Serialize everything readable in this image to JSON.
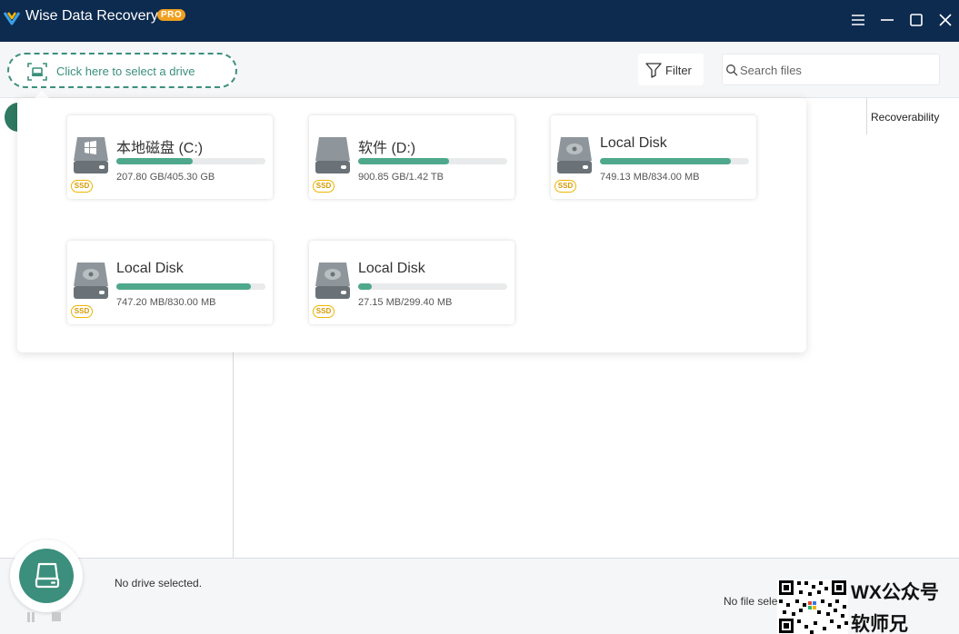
{
  "app": {
    "title": "Wise Data Recovery",
    "badge": "PRO"
  },
  "window_controls": [
    "menu-icon",
    "minimize-icon",
    "maximize-icon",
    "close-icon"
  ],
  "toolbar": {
    "drive_select_label": "Click here to select a drive",
    "filter_label": "Filter",
    "search_placeholder": "Search files"
  },
  "table": {
    "columns": [
      "Recoverability"
    ]
  },
  "drives": [
    {
      "name": "本地磁盘 (C:)",
      "usage": "207.80 GB/405.30 GB",
      "type": "SSD",
      "icon": "windows-drive-icon",
      "used_fraction": 0.51
    },
    {
      "name": "软件 (D:)",
      "usage": "900.85 GB/1.42 TB",
      "type": "SSD",
      "icon": "hard-drive-icon",
      "used_fraction": 0.61
    },
    {
      "name": "Local Disk",
      "usage": "749.13 MB/834.00 MB",
      "type": "SSD",
      "icon": "hard-drive-icon",
      "used_fraction": 0.88
    },
    {
      "name": "Local Disk",
      "usage": "747.20 MB/830.00 MB",
      "type": "SSD",
      "icon": "hard-drive-icon",
      "used_fraction": 0.9
    },
    {
      "name": "Local Disk",
      "usage": "27.15 MB/299.40 MB",
      "type": "SSD",
      "icon": "hard-drive-icon",
      "used_fraction": 0.09
    }
  ],
  "status": {
    "left": "No drive selected.",
    "right": "No file sele"
  },
  "watermark": {
    "line1": "WX公众号",
    "line2": "软师兄"
  },
  "colors": {
    "titlebar": "#0d2a4f",
    "accent": "#3b8f7c",
    "bar_fill": "#4fa88c",
    "pro_badge": "#f0a020",
    "ssd_badge": "#f0b400"
  }
}
